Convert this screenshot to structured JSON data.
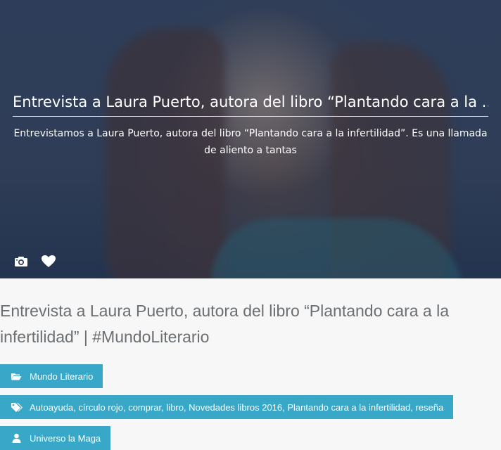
{
  "hero": {
    "title": "Entrevista a Laura Puerto, autora del libro “Plantando cara a la ...",
    "excerpt": "Entrevistamos a Laura Puerto, autora del libro “Plantando cara a la infertilidad”. Es una llamada de aliento a tantas",
    "icons": [
      "camera-icon",
      "heart-icon"
    ]
  },
  "post": {
    "title": "Entrevista a Laura Puerto, autora del libro “Plantando cara a la infertilidad” | #MundoLiterario"
  },
  "meta": {
    "category": {
      "icon": "folder-open-icon",
      "label": "Mundo Literario"
    },
    "tags": {
      "icon": "tags-icon",
      "label": "Autoayuda, círculo rojo, comprar, libro, Novedades libros 2016, Plantando cara a la infertilidad, reseña"
    },
    "author": {
      "icon": "user-icon",
      "label": "Universo la Maga"
    }
  },
  "colors": {
    "accent": "#39a7c7",
    "hero_overlay": "#2f3d57",
    "title_text": "#6a6f73"
  }
}
